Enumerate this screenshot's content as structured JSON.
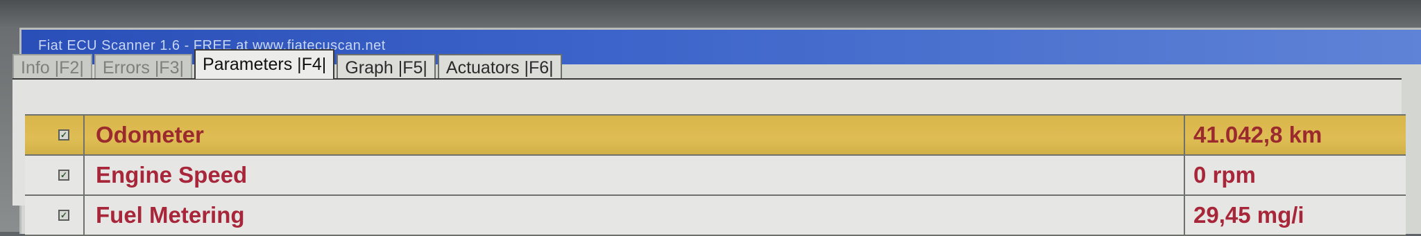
{
  "window": {
    "title": "Fiat ECU Scanner 1.6 - FREE at www.fiatecuscan.net"
  },
  "tabs": [
    {
      "label": "Info |F2|"
    },
    {
      "label": "Errors |F3|"
    },
    {
      "label": "Parameters |F4|"
    },
    {
      "label": "Graph |F5|"
    },
    {
      "label": "Actuators |F6|"
    }
  ],
  "active_tab": "Parameters |F4|",
  "parameters": [
    {
      "name": "Odometer",
      "value": "41.042,8 km",
      "checked": true,
      "selected": true
    },
    {
      "name": "Engine Speed",
      "value": "0 rpm",
      "checked": true,
      "selected": false
    },
    {
      "name": "Fuel Metering",
      "value": "29,45 mg/i",
      "checked": true,
      "selected": false
    }
  ],
  "colors": {
    "title_bar": "#3b63c9",
    "selected_row": "#dfbd55",
    "parameter_text": "#a8263a"
  },
  "icons": {
    "checkbox": "checked-checkbox-icon"
  }
}
